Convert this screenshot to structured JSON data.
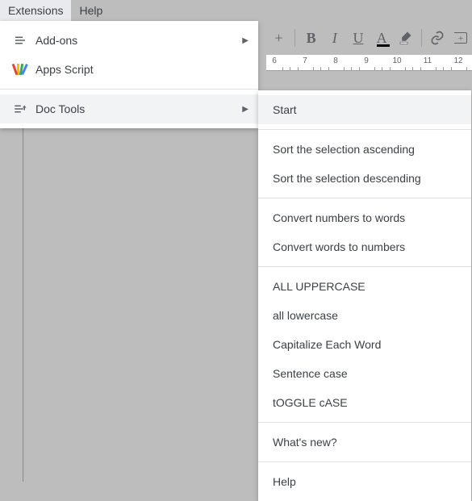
{
  "menubar": {
    "extensions": "Extensions",
    "help": "Help"
  },
  "toolbar": {
    "plus": "+",
    "bold": "B",
    "italic": "I",
    "underline": "U",
    "textcolor": "A",
    "link_icon": "link",
    "comment_plus": "+"
  },
  "ruler": {
    "marks": [
      "6",
      "7",
      "8",
      "9",
      "10",
      "11",
      "12"
    ]
  },
  "dropdown": {
    "addons": "Add-ons",
    "apps_script": "Apps Script",
    "doc_tools": "Doc Tools"
  },
  "submenu": {
    "groups": [
      [
        "Start"
      ],
      [
        "Sort the selection ascending",
        "Sort the selection descending"
      ],
      [
        "Convert numbers to words",
        "Convert words to numbers"
      ],
      [
        "ALL UPPERCASE",
        "all lowercase",
        "Capitalize Each Word",
        "Sentence case",
        "tOGGLE cASE"
      ],
      [
        "What's new?"
      ],
      [
        "Help"
      ]
    ]
  }
}
